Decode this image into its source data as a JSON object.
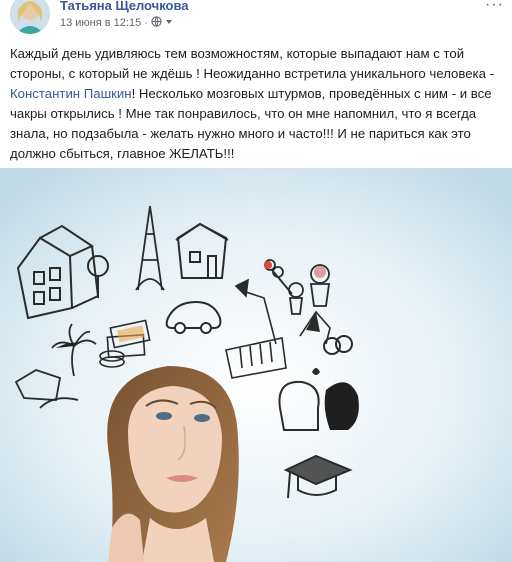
{
  "post": {
    "author": "Татьяна Щелочкова",
    "date": "13 июня в 12:15",
    "separator": "·",
    "privacy_icon": "globe-icon",
    "more_icon": "more-dots-icon",
    "text_part1": "Каждый день удивляюсь тем возможностям, которые выпадают нам с той стороны, с который не ждёшь ! Неожиданно встретила уникального человека - ",
    "mention": "Константин Пашкин",
    "text_part2": "! Несколько мозговых штурмов, проведённых с ним - и все чакры открылись ! Мне так понравилось, что он мне напомнил, что я всегда знала, но подзабыла - желать нужно много и часто!!! И не париться как это должно сбыться, главное ЖЕЛАТЬ!!!"
  },
  "colors": {
    "link": "#385898",
    "text": "#1c1e21",
    "meta": "#616770",
    "image_bg": "#cfe4ef"
  }
}
